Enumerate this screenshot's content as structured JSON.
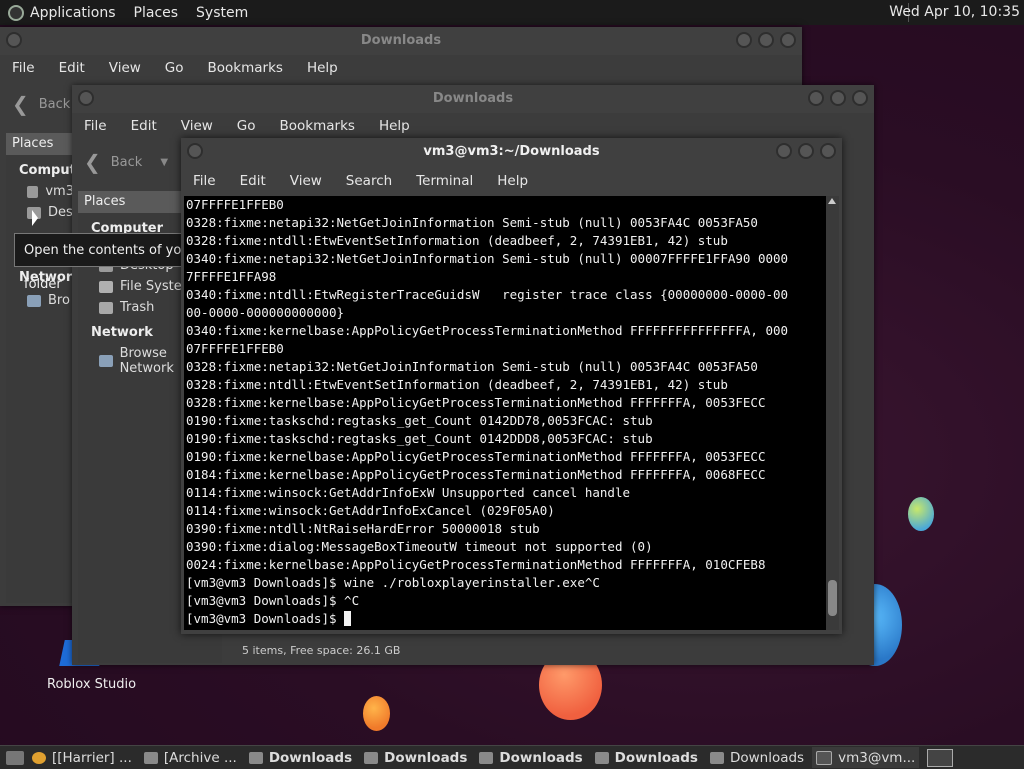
{
  "top_panel": {
    "menus": [
      "Applications",
      "Places",
      "System"
    ],
    "clock": "Wed Apr 10, 10:35"
  },
  "desktop": {
    "icons": [
      {
        "label": "Roblox Studio",
        "icon": "roblox-studio-icon"
      }
    ]
  },
  "window1": {
    "title": "Downloads",
    "menus": [
      "File",
      "Edit",
      "View",
      "Go",
      "Bookmarks",
      "Help"
    ],
    "back_label": "Back",
    "sidebar_head": "Places",
    "sidebar": {
      "computer_label": "Compute",
      "home_label": "vm3",
      "desktop_label": "Des",
      "network_label": "Network",
      "browse_label": "Bro"
    }
  },
  "window2": {
    "title": "Downloads",
    "menus": [
      "File",
      "Edit",
      "View",
      "Go",
      "Bookmarks",
      "Help"
    ],
    "back_label": "Back",
    "sidebar_head": "Places",
    "sidebar": {
      "computer_label": "Computer",
      "items": [
        "Desktop",
        "File System",
        "Trash"
      ],
      "network_label": "Network",
      "browse_label": "Browse Network"
    },
    "status": "5 items, Free space: 26.1 GB"
  },
  "tooltip": "Open the contents of your desktop in a folder",
  "terminal": {
    "title": "vm3@vm3:~/Downloads",
    "menus": [
      "File",
      "Edit",
      "View",
      "Search",
      "Terminal",
      "Help"
    ],
    "lines": [
      "07FFFFE1FFEB0",
      "0328:fixme:netapi32:NetGetJoinInformation Semi-stub (null) 0053FA4C 0053FA50",
      "0328:fixme:ntdll:EtwEventSetInformation (deadbeef, 2, 74391EB1, 42) stub",
      "0340:fixme:netapi32:NetGetJoinInformation Semi-stub (null) 00007FFFFE1FFA90 0000",
      "7FFFFE1FFA98",
      "0340:fixme:ntdll:EtwRegisterTraceGuidsW   register trace class {00000000-0000-00",
      "00-0000-000000000000}",
      "0340:fixme:kernelbase:AppPolicyGetProcessTerminationMethod FFFFFFFFFFFFFFFA, 000",
      "07FFFFE1FFEB0",
      "0328:fixme:netapi32:NetGetJoinInformation Semi-stub (null) 0053FA4C 0053FA50",
      "0328:fixme:ntdll:EtwEventSetInformation (deadbeef, 2, 74391EB1, 42) stub",
      "0328:fixme:kernelbase:AppPolicyGetProcessTerminationMethod FFFFFFFA, 0053FECC",
      "0190:fixme:taskschd:regtasks_get_Count 0142DD78,0053FCAC: stub",
      "0190:fixme:taskschd:regtasks_get_Count 0142DDD8,0053FCAC: stub",
      "0190:fixme:kernelbase:AppPolicyGetProcessTerminationMethod FFFFFFFA, 0053FECC",
      "0184:fixme:kernelbase:AppPolicyGetProcessTerminationMethod FFFFFFFA, 0068FECC",
      "0114:fixme:winsock:GetAddrInfoExW Unsupported cancel handle",
      "0114:fixme:winsock:GetAddrInfoExCancel (029F05A0)",
      "0390:fixme:ntdll:NtRaiseHardError 50000018 stub",
      "0390:fixme:dialog:MessageBoxTimeoutW timeout not supported (0)",
      "0024:fixme:kernelbase:AppPolicyGetProcessTerminationMethod FFFFFFFA, 010CFEB8",
      "[vm3@vm3 Downloads]$ wine ./robloxplayerinstaller.exe^C",
      "[vm3@vm3 Downloads]$ ^C"
    ],
    "prompt": "[vm3@vm3 Downloads]$ "
  },
  "taskbar": {
    "items": [
      {
        "label": "[[Harrier] ...",
        "icon": "chrome-icon",
        "bold": false
      },
      {
        "label": "[Archive ...",
        "icon": "archive-icon",
        "bold": false
      },
      {
        "label": "Downloads",
        "icon": "folder-icon",
        "bold": true
      },
      {
        "label": "Downloads",
        "icon": "folder-icon",
        "bold": true
      },
      {
        "label": "Downloads",
        "icon": "folder-icon",
        "bold": true
      },
      {
        "label": "Downloads",
        "icon": "folder-icon",
        "bold": true
      },
      {
        "label": "Downloads",
        "icon": "folder-icon",
        "bold": false
      },
      {
        "label": "vm3@vm...",
        "icon": "terminal-icon",
        "bold": false
      }
    ]
  }
}
